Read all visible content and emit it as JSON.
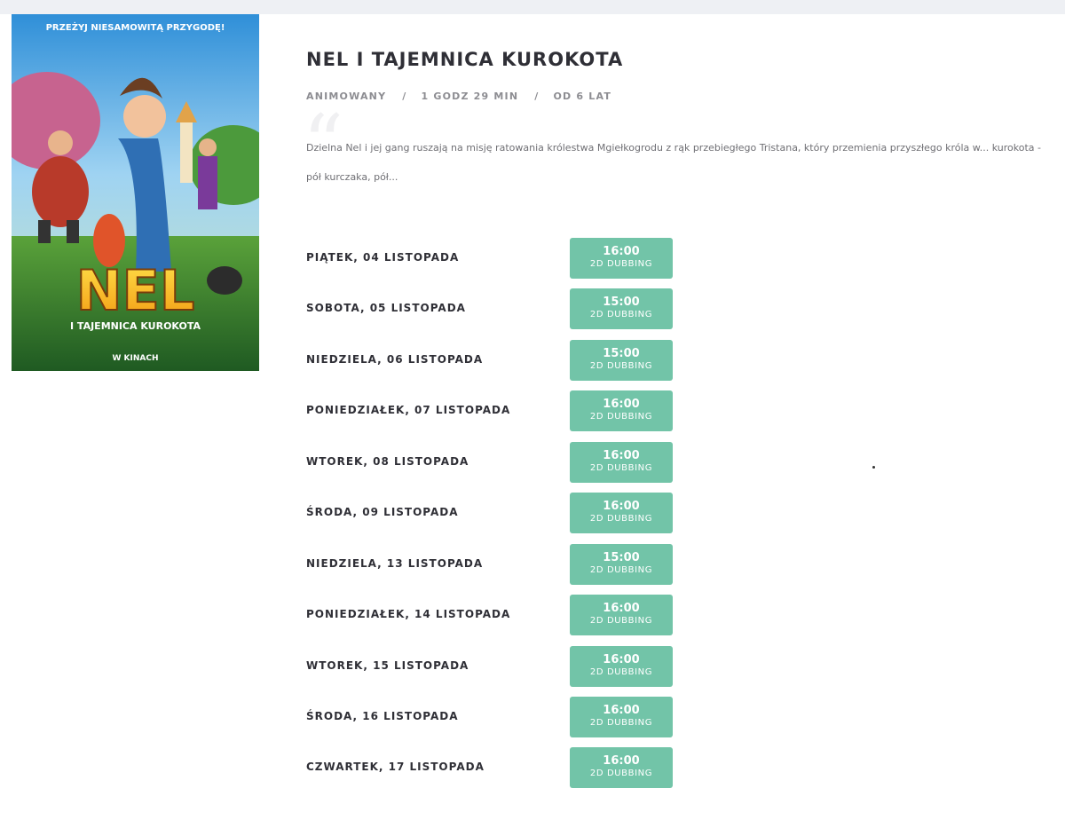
{
  "poster": {
    "tagline": "PRZEŻYJ NIESAMOWITĄ PRZYGODĘ!",
    "logo_big": "NEL",
    "logo_sub": "I TAJEMNICA KUROKOTA",
    "footer": "W KINACH"
  },
  "movie": {
    "title": "NEL I TAJEMNICA KUROKOTA",
    "genre": "ANIMOWANY",
    "duration": "1 GODZ 29 MIN",
    "age": "OD 6 LAT",
    "separator": "/",
    "description": "Dzielna Nel i jej gang ruszają na misję ratowania królestwa Mgiełkogrodu z rąk przebiegłego Tristana, który przemienia przyszłego króla w... kurokota - pół kurczaka, pół..."
  },
  "colors": {
    "accent": "#72c4a8",
    "title": "#2f2f36",
    "meta": "#8d8d92"
  },
  "showtimes": [
    {
      "day": "PIĄTEK, 04 LISTOPADA",
      "time": "16:00",
      "format": "2D DUBBING"
    },
    {
      "day": "SOBOTA, 05 LISTOPADA",
      "time": "15:00",
      "format": "2D DUBBING"
    },
    {
      "day": "NIEDZIELA, 06 LISTOPADA",
      "time": "15:00",
      "format": "2D DUBBING"
    },
    {
      "day": "PONIEDZIAŁEK, 07 LISTOPADA",
      "time": "16:00",
      "format": "2D DUBBING"
    },
    {
      "day": "WTOREK, 08 LISTOPADA",
      "time": "16:00",
      "format": "2D DUBBING"
    },
    {
      "day": "ŚRODA, 09 LISTOPADA",
      "time": "16:00",
      "format": "2D DUBBING"
    },
    {
      "day": "NIEDZIELA, 13 LISTOPADA",
      "time": "15:00",
      "format": "2D DUBBING"
    },
    {
      "day": "PONIEDZIAŁEK, 14 LISTOPADA",
      "time": "16:00",
      "format": "2D DUBBING"
    },
    {
      "day": "WTOREK, 15 LISTOPADA",
      "time": "16:00",
      "format": "2D DUBBING"
    },
    {
      "day": "ŚRODA, 16 LISTOPADA",
      "time": "16:00",
      "format": "2D DUBBING"
    },
    {
      "day": "CZWARTEK, 17 LISTOPADA",
      "time": "16:00",
      "format": "2D DUBBING"
    }
  ]
}
